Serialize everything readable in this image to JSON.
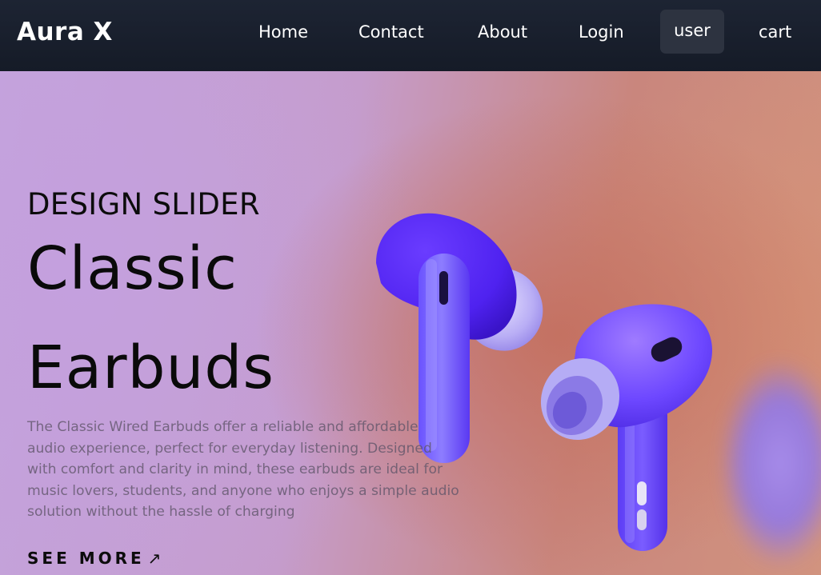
{
  "header": {
    "logo": "Aura X",
    "nav": {
      "home": "Home",
      "contact": "Contact",
      "about": "About",
      "login": "Login",
      "user": "user",
      "cart": "cart"
    }
  },
  "hero": {
    "eyebrow": "DESIGN SLIDER",
    "title_line_1": "Classic",
    "title_line_2": "Earbuds",
    "description": "The Classic Wired Earbuds offer a reliable and affordable audio experience, perfect for everyday listening. Designed with comfort and clarity in mind, these earbuds are ideal for music lovers, students, and anyone who enjoys a simple audio solution without the hassle of charging",
    "cta_label": "SEE MORE",
    "cta_arrow": "↗",
    "product_image": "earbuds-image"
  },
  "colors": {
    "nav_bg": "#1a2130",
    "user_chip_bg": "#2d3340",
    "earbud": "#5b3cff",
    "hero_purple": "#c4a4dc",
    "hero_orange": "#c9867d"
  }
}
